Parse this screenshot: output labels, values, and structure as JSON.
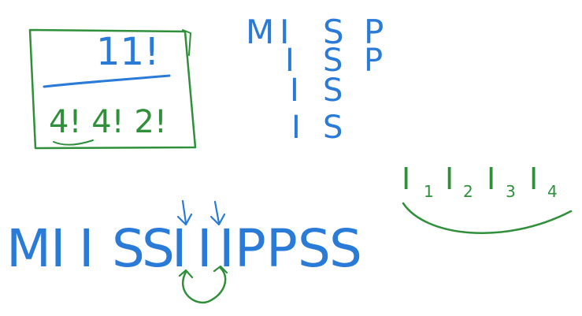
{
  "box": {
    "numerator": "11!",
    "denominator": "4! 4! 2!"
  },
  "letter_table": {
    "columns": [
      [
        "M",
        "I",
        "S",
        "P"
      ],
      [
        "I",
        "S",
        "P"
      ],
      [
        "I",
        "S"
      ],
      [
        "I",
        "S"
      ]
    ]
  },
  "word": {
    "letters": [
      "M",
      "I",
      "I",
      "S",
      "S",
      "I",
      "I",
      "I",
      "P",
      "P",
      "S",
      "S"
    ]
  },
  "subscripts": {
    "items": [
      {
        "base": "I",
        "sub": "1"
      },
      {
        "base": "I",
        "sub": "2"
      },
      {
        "base": "I",
        "sub": "3"
      },
      {
        "base": "I",
        "sub": "4"
      }
    ]
  },
  "colors": {
    "blue_ink": "#2a7ad8",
    "green_ink": "#2f8f3a",
    "background": "#ffffff"
  }
}
